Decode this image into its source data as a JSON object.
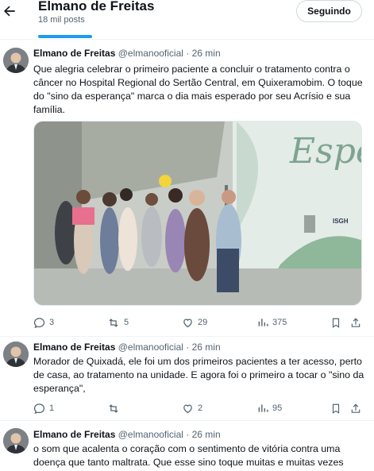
{
  "header": {
    "name": "Elmano de Freitas",
    "post_count": "18 mil posts",
    "follow_label": "Seguindo",
    "back_icon": "arrow-left-icon"
  },
  "tweets": [
    {
      "name": "Elmano de Freitas",
      "handle": "@elmanooficial",
      "dot": "·",
      "time": "26 min",
      "text": "Que alegria celebrar o primeiro paciente a concluir o tratamento contra o câncer no Hospital Regional do Sertão Central, em Quixeramobim. O toque do \"sino da esperança\" marca o dia mais esperado por seu Acrísio e sua família.",
      "media": {
        "wall_text": "Espe",
        "logo_text": "ISGH"
      },
      "replies": "3",
      "reposts": "5",
      "likes": "29",
      "views": "375"
    },
    {
      "name": "Elmano de Freitas",
      "handle": "@elmanooficial",
      "dot": "·",
      "time": "26 min",
      "text": "Morador de Quixadá, ele foi um dos primeiros pacientes a ter acesso, perto de casa, ao tratamento na unidade. E agora foi o primeiro a tocar o \"sino da esperança\",",
      "replies": "1",
      "reposts": "",
      "likes": "2",
      "views": "95"
    },
    {
      "name": "Elmano de Freitas",
      "handle": "@elmanooficial",
      "dot": "·",
      "time": "26 min",
      "text": "o som que acalenta o coração com o sentimento de vitória contra uma doença que tanto maltrata. Que esse sino toque muitas e muitas vezes"
    }
  ],
  "colors": {
    "accent": "#1d9bf0",
    "secondary_text": "#536471",
    "border": "#eff3f4"
  }
}
